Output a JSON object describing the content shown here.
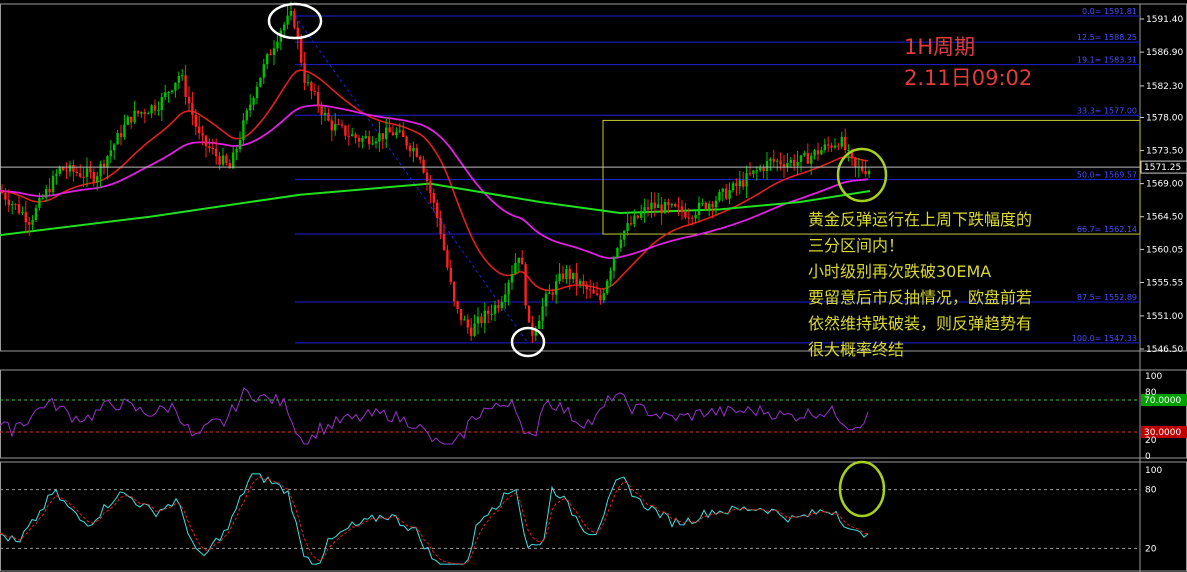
{
  "caption": {
    "timeframe": "1H周期",
    "datetime": "2.11日09:02"
  },
  "notes": [
    "黄金反弹运行在上周下跌幅度的",
    "三分区间内！",
    "小时级别再次跌破30EMA",
    "要留意后市反抽情况，欧盘前若",
    "依然维持跌破装，则反弹趋势有",
    "很大概率终结"
  ],
  "colors": {
    "background": "#000000",
    "bull_candle": "#00c000",
    "bear_candle": "#ff2020",
    "ema_fast": "#e02020",
    "ema_mid": "#e020e0",
    "ema_slow": "#20e020",
    "fib_line": "#2020d8",
    "range_box": "#c8c832",
    "rsi_line": "#9932cc",
    "stoch_k": "#40e0e0",
    "stoch_d": "#e02020",
    "highlight_circle": "#ffffff",
    "marker_circle": "#a8d020"
  },
  "chart_data": [
    {
      "type": "candlestick",
      "panel": "price",
      "y_ticks": [
        "1591.40",
        "1586.90",
        "1582.30",
        "1578.00",
        "1573.50",
        "1569.00",
        "1564.50",
        "1560.05",
        "1555.55",
        "1551.00",
        "1546.50"
      ],
      "ylim": [
        1546.5,
        1591.4
      ],
      "current_price": "1571.25",
      "fibonacci_levels": [
        {
          "label": "0.0= 1591.81",
          "value": 1591.8
        },
        {
          "label": "12.5= 1588.25",
          "value": 1588.25
        },
        {
          "label": "19.1= 1583.31",
          "value": 1585.2
        },
        {
          "label": "33.3= 1577.00",
          "value": 1578.3
        },
        {
          "label": "50.0= 1569.57",
          "value": 1569.57
        },
        {
          "label": "66.7= 1562.14",
          "value": 1562.14
        },
        {
          "label": "87.5= 1552.89",
          "value": 1552.89
        },
        {
          "label": "100.0= 1547.33",
          "value": 1547.33
        }
      ],
      "ema_series_colors": [
        "ema_fast",
        "ema_mid",
        "ema_slow"
      ],
      "annotation": "swing high 1591.8 and swing low 1547.3 circled; retracement box 1562–1577"
    },
    {
      "type": "line",
      "panel": "rsi",
      "y_ticks": [
        "100",
        "80",
        "20",
        "0"
      ],
      "levels": [
        {
          "label": "70.0000",
          "value": 70
        },
        {
          "label": "30.0000",
          "value": 30
        }
      ],
      "ylim": [
        0,
        100
      ]
    },
    {
      "type": "line",
      "panel": "stochastic",
      "y_ticks": [
        "100",
        "80",
        "20"
      ],
      "levels": [
        80,
        20
      ],
      "ylim": [
        0,
        100
      ]
    }
  ]
}
